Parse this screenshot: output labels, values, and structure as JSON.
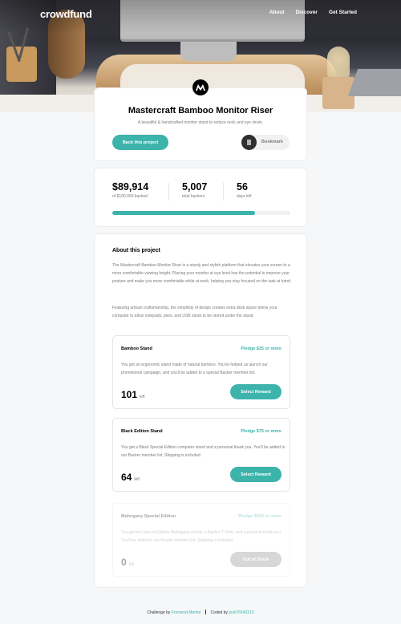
{
  "nav": {
    "logo": "crowdfund",
    "links": [
      "About",
      "Discover",
      "Get Started"
    ]
  },
  "project": {
    "title": "Mastercraft Bamboo Monitor Riser",
    "subtitle": "A beautiful & handcrafted monitor stand to reduce neck and eye strain.",
    "back_label": "Back this project",
    "bookmark_label": "Bookmark"
  },
  "stats": {
    "backed_amount": "$89,914",
    "backed_label": "of $100,000 backed",
    "backers": "5,007",
    "backers_label": "total backers",
    "days": "56",
    "days_label": "days left",
    "progress_fraction": 0.8
  },
  "about": {
    "title": "About this project",
    "p1": "The Mastercraft Bamboo Monitor Riser is a sturdy and stylish platform that elevates your screen to a more comfortable viewing height. Placing your monitor at eye level has the potential to improve your posture and make you more comfortable while at work, helping you stay focused on the task at hand.",
    "p2": "Featuring artisan craftsmanship, the simplicity of design creates extra desk space below your computer to allow notepads, pens, and USB sticks to be stored under the stand."
  },
  "rewards": [
    {
      "name": "Bamboo Stand",
      "pledge": "Pledge $25 or more",
      "desc": "You get an ergonomic stand made of natural bamboo. You've helped us launch our promotional campaign, and you'll be added to a special Backer member list.",
      "count": "101",
      "left_label": "left",
      "button": "Select Reward"
    },
    {
      "name": "Black Edition Stand",
      "pledge": "Pledge $75 or more",
      "desc": "You get a Black Special Edition computer stand and a personal thank you. You'll be added to our Backer member list. Shipping is included.",
      "count": "64",
      "left_label": "left",
      "button": "Select Reward"
    },
    {
      "name": "Mahogany Special Edition",
      "pledge": "Pledge $200 or more",
      "desc": "You get two Special Edition Mahogany stands, a Backer T-Shirt, and a personal thank you. You'll be added to our Backer member list. Shipping is included.",
      "count": "0",
      "left_label": "left",
      "button": "Out of Stock"
    }
  ],
  "footer": {
    "challenge_text": "Challenge by",
    "challenge_link": "Frontend Mentor",
    "coded_text": "Coded by",
    "coded_link": "josh76543210"
  },
  "colors": {
    "accent": "#3cb3ab",
    "text_dark": "#000000",
    "text_muted": "#7a7a7a",
    "background": "#f6f7f9"
  }
}
